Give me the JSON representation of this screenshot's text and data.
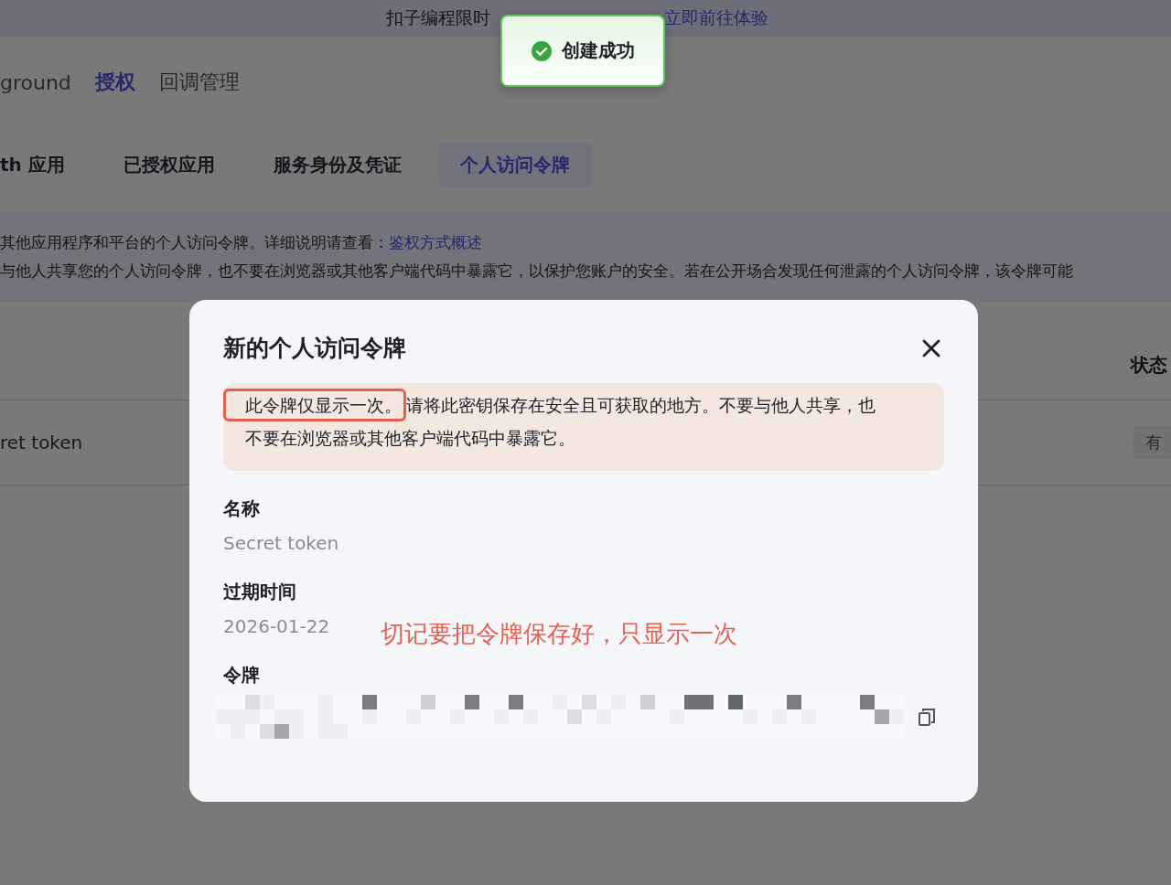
{
  "banner": {
    "text": "扣子编程限时",
    "link": "立即前往体验"
  },
  "toast": {
    "text": "创建成功"
  },
  "nav": [
    {
      "label": "ground",
      "selected": false
    },
    {
      "label": "授权",
      "selected": true
    },
    {
      "label": "回调管理",
      "selected": false
    }
  ],
  "tabs": [
    {
      "label": "th 应用",
      "selected": false
    },
    {
      "label": "已授权应用",
      "selected": false
    },
    {
      "label": "服务身份及凭证",
      "selected": false
    },
    {
      "label": "个人访问令牌",
      "selected": true
    }
  ],
  "info": {
    "line1": "其他应用程序和平台的个人访问令牌。详细说明请查看：",
    "link": "鉴权方式概述",
    "line2": "与他人共享您的个人访问令牌，也不要在浏览器或其他客户端代码中暴露它，以保护您账户的安全。若在公开场合发现任何泄露的个人访问令牌，该令牌可能"
  },
  "table": {
    "status_header": "状态",
    "row_name": "ret token",
    "row_status": "有"
  },
  "dialog": {
    "title": "新的个人访问令牌",
    "warning_highlight": "此令牌仅显示一次。",
    "warning_text": "请将此密钥保存在安全且可获取的地方。不要与他人共享，也不要在浏览器或其他客户端代码中暴露它。",
    "fields": [
      {
        "label": "名称",
        "value": "Secret token"
      },
      {
        "label": "过期时间",
        "value": "2026-01-22"
      },
      {
        "label": "令牌"
      }
    ],
    "annotation": "切记要把令牌保存好，只显示一次"
  }
}
